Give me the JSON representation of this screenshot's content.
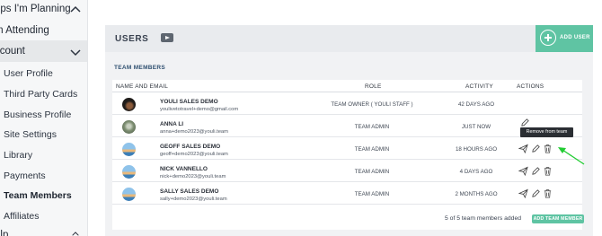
{
  "sidebar": {
    "items": [
      {
        "label": "rips I'm Planning",
        "type": "top",
        "chevron": "up"
      },
      {
        "label": "m Attending",
        "type": "top"
      },
      {
        "label": "ccount",
        "type": "top",
        "chevron": "down"
      },
      {
        "label": "User Profile",
        "type": "sub"
      },
      {
        "label": "Third Party Cards",
        "type": "sub"
      },
      {
        "label": "Business Profile",
        "type": "sub"
      },
      {
        "label": "Site Settings",
        "type": "sub"
      },
      {
        "label": "Library",
        "type": "sub"
      },
      {
        "label": "Payments",
        "type": "sub"
      },
      {
        "label": "Team Members",
        "type": "sub",
        "active": true
      },
      {
        "label": "Affiliates",
        "type": "sub"
      },
      {
        "label": "elp",
        "type": "top",
        "chevron": "up"
      }
    ]
  },
  "users_panel": {
    "title": "USERS",
    "video_icon": "video-play-icon",
    "add_user_label": "ADD USER",
    "team_members_title": "TEAM MEMBERS",
    "columns": {
      "name_email": "NAME AND EMAIL",
      "role": "ROLE",
      "activity": "ACTIVITY",
      "actions": "ACTIONS"
    },
    "rows": [
      {
        "name": "YOULI SALES DEMO",
        "email": "youlivetotravel+demo@gmail.com",
        "role": "TEAM OWNER ( YOULI STAFF )",
        "activity": "42 DAYS AGO",
        "actions": [],
        "avatar_color": "#2b2a28"
      },
      {
        "name": "ANNA LI",
        "email": "anna+demo2023@youli.team",
        "role": "TEAM ADMIN",
        "activity": "JUST NOW",
        "actions": [
          "edit"
        ],
        "avatar_color": "#8a9a7c"
      },
      {
        "name": "GEOFF SALES DEMO",
        "email": "geoff+demo2023@youli.team",
        "role": "TEAM ADMIN",
        "activity": "18 HOURS AGO",
        "actions": [
          "send",
          "edit",
          "delete"
        ],
        "avatar_color": "#4f8fc9"
      },
      {
        "name": "NICK VANNELLO",
        "email": "nick+demo2023@youli.team",
        "role": "TEAM ADMIN",
        "activity": "4 DAYS AGO",
        "actions": [
          "send",
          "edit",
          "delete"
        ],
        "avatar_color": "#4f8fc9"
      },
      {
        "name": "SALLY SALES DEMO",
        "email": "sally+demo2023@youli.team",
        "role": "TEAM ADMIN",
        "activity": "2 MONTHS AGO",
        "actions": [
          "send",
          "edit",
          "delete"
        ],
        "avatar_color": "#4f8fc9"
      }
    ],
    "tooltip": "Remove from team",
    "member_count_text": "5 of 5 team members added",
    "add_team_member_label": "ADD TEAM MEMBER"
  },
  "colors": {
    "accent": "#5fc4a3",
    "annotation_arrow": "#22cc33",
    "tooltip_bg": "#2b2e33"
  }
}
